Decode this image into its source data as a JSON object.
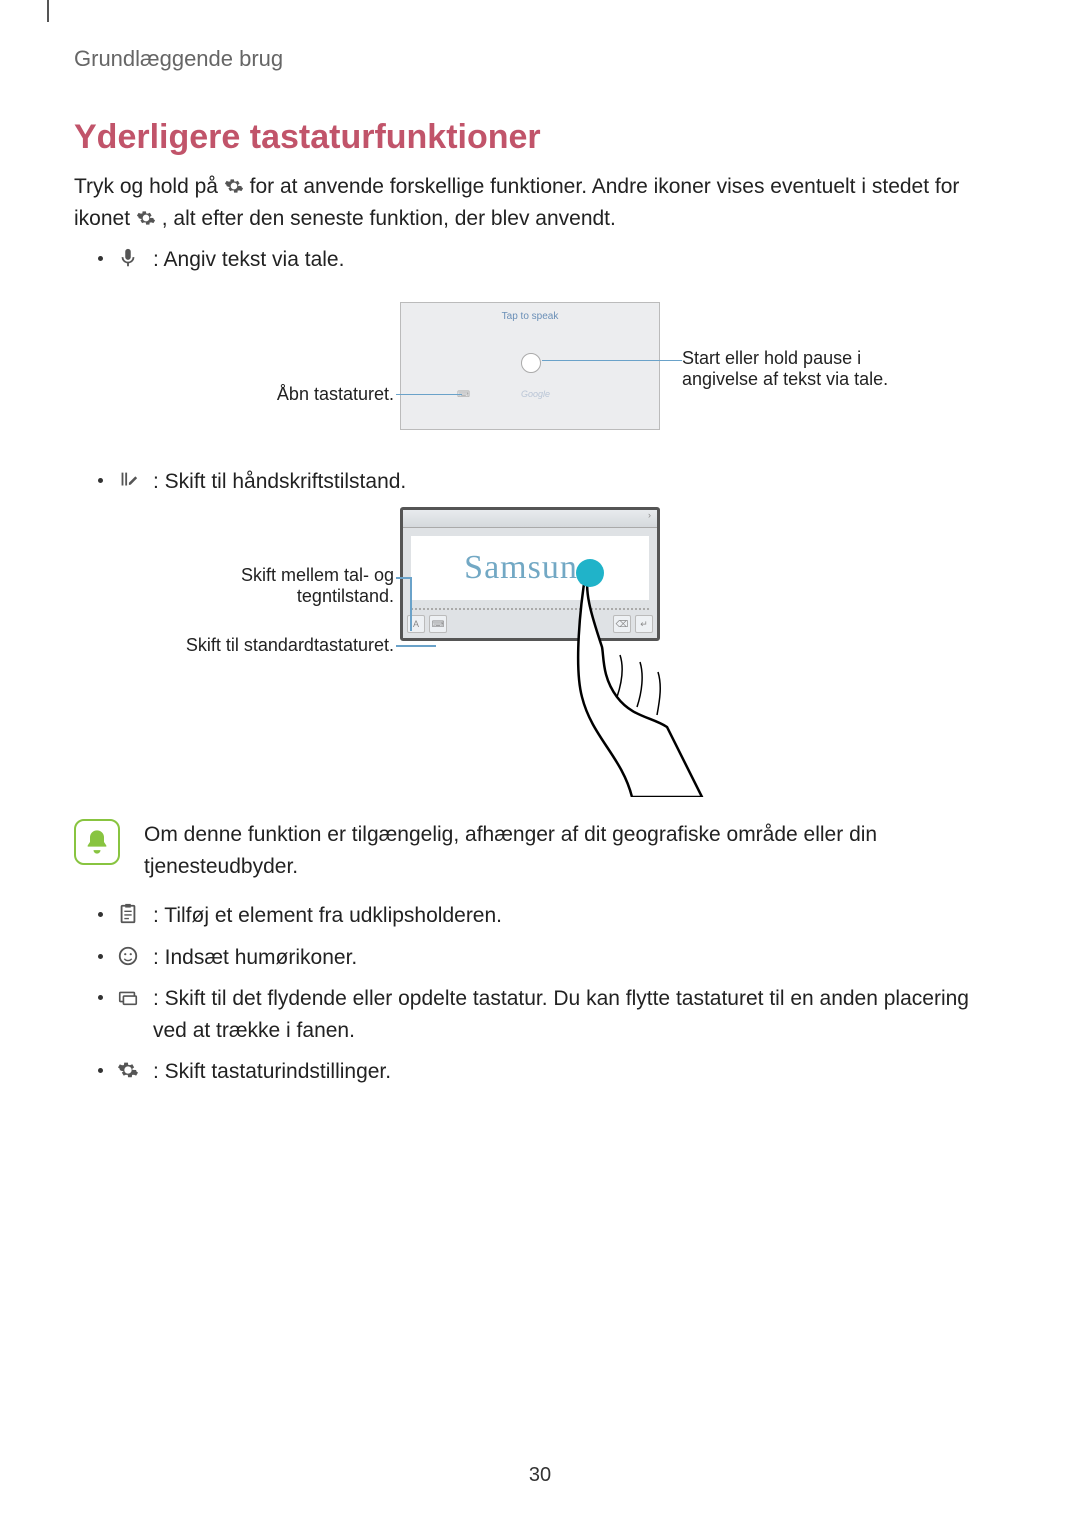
{
  "breadcrumb": "Grundlæggende brug",
  "heading": "Yderligere tastaturfunktioner",
  "intro": {
    "part1": "Tryk og hold på ",
    "part2": " for at anvende forskellige funktioner. Andre ikoner vises eventuelt i stedet for ikonet ",
    "part3": ", alt efter den seneste funktion, der blev anvendt."
  },
  "bullets1": {
    "voice": " : Angiv tekst via tale."
  },
  "fig1": {
    "tap_to_speak": "Tap to speak",
    "google": "Google",
    "left_label": "Åbn tastaturet.",
    "right_label": "Start eller hold pause i angivelse af tekst via tale."
  },
  "bullets2": {
    "handwriting": " : Skift til håndskriftstilstand."
  },
  "fig2": {
    "samsung": "Samsung",
    "left_label_1": "Skift mellem tal- og tegntilstand.",
    "left_label_2": "Skift til standardtastaturet."
  },
  "note": "Om denne funktion er tilgængelig, afhænger af dit geografiske område eller din tjenesteudbyder.",
  "bullets3": {
    "clipboard": " : Tilføj et element fra udklipsholderen.",
    "emoji": " : Indsæt humørikoner.",
    "floating": " : Skift til det flydende eller opdelte tastatur. Du kan flytte tastaturet til en anden placering ved at trække i fanen.",
    "settings": " : Skift tastaturindstillinger."
  },
  "page_number": "30"
}
